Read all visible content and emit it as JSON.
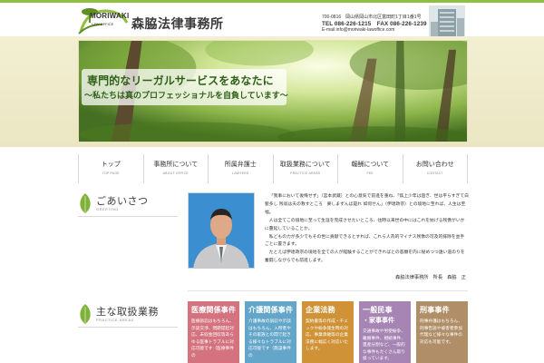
{
  "header": {
    "logo_en": "MORIWAKI",
    "logo_sub": "LAW OFFICE",
    "logo_ja": "森脇法律事務所",
    "zip_address": "700-0816　岡山県岡山市北区富田町1丁目1番1号",
    "tel_fax": "TEL 086-226-1215　FAX 086-226-1239",
    "email": "E-mail info@moriwaki-lawoffice.com"
  },
  "hero": {
    "title": "専門的なリーガルサービスをあなたに",
    "subtitle": "～私たちは真のプロフェッショナルを自負しています～"
  },
  "nav": [
    {
      "ja": "トップ",
      "en": "TOP PAGE"
    },
    {
      "ja": "事務所について",
      "en": "ABOUT OFFICE"
    },
    {
      "ja": "所属弁護士",
      "en": "LAWYERS"
    },
    {
      "ja": "取扱業務について",
      "en": "PRACTICE AREAS"
    },
    {
      "ja": "報酬について",
      "en": "FEE"
    },
    {
      "ja": "お問い合わせ",
      "en": "CONTACT"
    }
  ],
  "greeting": {
    "title": "ごあいさつ",
    "title_en": "GREETING",
    "paragraphs": [
      "「我事において後悔せず」（宮本武蔵）との心意気で前進を重ね、「焦上少年は過ぎ、世は平らすぎて白髪多し 残翁は天の救すところ　楽しまずんば是れ 如何せん」（伊達政宗）との境地に至れば、人生は至福。",
      "人は全てこの境地に至って生涯を完成させたいところ、往時以来世の中にはこれを妨げる残像がいかに蔓延していることか。",
      "私どもの力が多少でもその世に貢献できるとすれば、これら人為的マイナス残像の可及的排除を並手ごとに置きます。",
      "たとえば伊達政宗の境地を全ての人が経験することができればとの悲願を内に秘めつつ遠い道のりを奮闘しながらでも前進します。"
    ],
    "signature": "森脇法律事務所　所長　森脇　正"
  },
  "practice": {
    "title": "主な取扱業務",
    "title_en": "PRACTICE AREAS",
    "cards": [
      {
        "title": "医療関係事件",
        "sub": "",
        "body": "医療訴訟はもちろん、示談交渉、問題提起対応、未収金回収等あらゆる医事トラブルに対応可能です（医療事件の",
        "color": "#d4737f"
      },
      {
        "title": "介護関係事件",
        "sub": "",
        "body": "介護事故の訴訟や示談はもちろん、入所者やその家族との間で起きる様々なトラブルに対応可能です（施設事件の",
        "color": "#63a6c9"
      },
      {
        "title": "企業法務",
        "sub": "",
        "body": "契約書等の作成・チェックや紛争発生時の対応、事業承継等の企業法務に幅広く対応いたします。",
        "color": "#d09236"
      },
      {
        "title": "一般民事",
        "sub": "・家事事件",
        "body": "交通事故や労使紛争、離婚事件、相続事件、遺産分割など、一般的な事件もたくさん取り扱っています。",
        "color": "#a684b3"
      },
      {
        "title": "刑事事件",
        "sub": "",
        "body": "刑事弁護はもちろん、刑事告訴や被害者参加代理など様々な事件の対応も可能です。",
        "color": "#b08f68"
      }
    ]
  },
  "colors": {
    "accent_green": "#8fbf3f",
    "hero_text": "#2e5f17",
    "band": "#f2efd3"
  }
}
